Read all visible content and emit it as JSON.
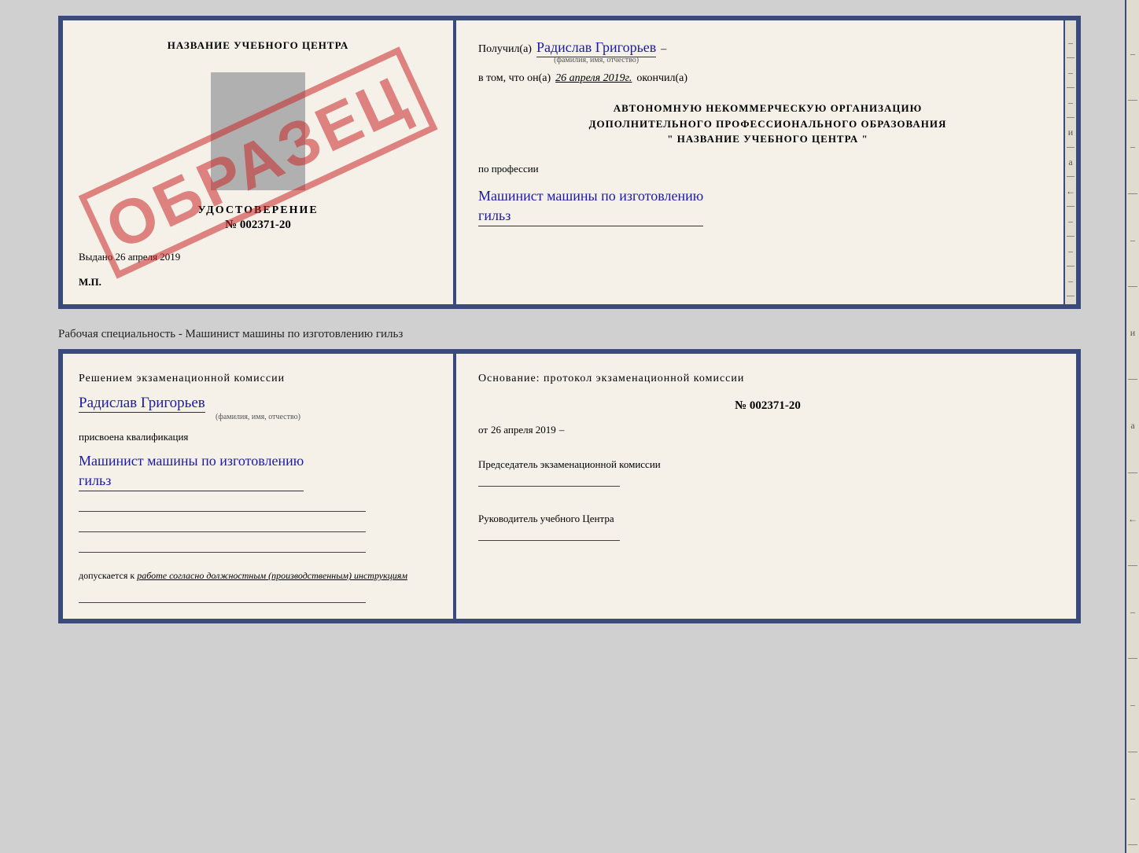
{
  "top_doc": {
    "left": {
      "title": "НАЗВАНИЕ УЧЕБНОГО ЦЕНТРА",
      "stamp": "ОБРАЗЕЦ",
      "udostoverenie_label": "УДОСТОВЕРЕНИЕ",
      "udostoverenie_num": "№ 002371-20",
      "vydano_prefix": "Выдано",
      "vydano_date": "26 апреля 2019",
      "mp": "М.П."
    },
    "right": {
      "poluchil_prefix": "Получил(а)",
      "fio": "Радислав Григорьев",
      "fio_sub": "(фамилия, имя, отчество)",
      "vtom_prefix": "в том, что он(а)",
      "vtom_date": "26 апреля 2019г.",
      "vtom_suffix": "окончил(а)",
      "org_line1": "АВТОНОМНУЮ НЕКОММЕРЧЕСКУЮ ОРГАНИЗАЦИЮ",
      "org_line2": "ДОПОЛНИТЕЛЬНОГО ПРОФЕССИОНАЛЬНОГО ОБРАЗОВАНИЯ",
      "org_line3": "\" НАЗВАНИЕ УЧЕБНОГО ЦЕНТРА \"",
      "profession_label": "по профессии",
      "profession_value_line1": "Машинист машины по изготовлению",
      "profession_value_line2": "гильз",
      "side_letters": [
        "и",
        "а",
        "←",
        "–",
        "–",
        "–"
      ]
    }
  },
  "separator": "Рабочая специальность - Машинист машины по изготовлению гильз",
  "bottom_doc": {
    "left": {
      "decision_title": "Решением  экзаменационной  комиссии",
      "fio": "Радислав Григорьев",
      "fio_sub": "(фамилия, имя, отчество)",
      "prisvoena_label": "присвоена квалификация",
      "qualification_line1": "Машинист  машины  по  изготовлению",
      "qualification_line2": "гильз",
      "dopuskaetsya_prefix": "допускается к",
      "dopuskaetsya_value": "работе согласно должностным (производственным) инструкциям"
    },
    "right": {
      "osnovaniye": "Основание: протокол экзаменационной  комиссии",
      "num_label": "№",
      "num": "002371-20",
      "ot_prefix": "от",
      "ot_date": "26 апреля 2019",
      "predsedatel_label": "Председатель экзаменационной комиссии",
      "rukovoditel_label": "Руководитель учебного Центра",
      "side_marks": [
        "–",
        "–",
        "–",
        "и",
        "а",
        "←",
        "–",
        "–",
        "–"
      ]
    }
  }
}
